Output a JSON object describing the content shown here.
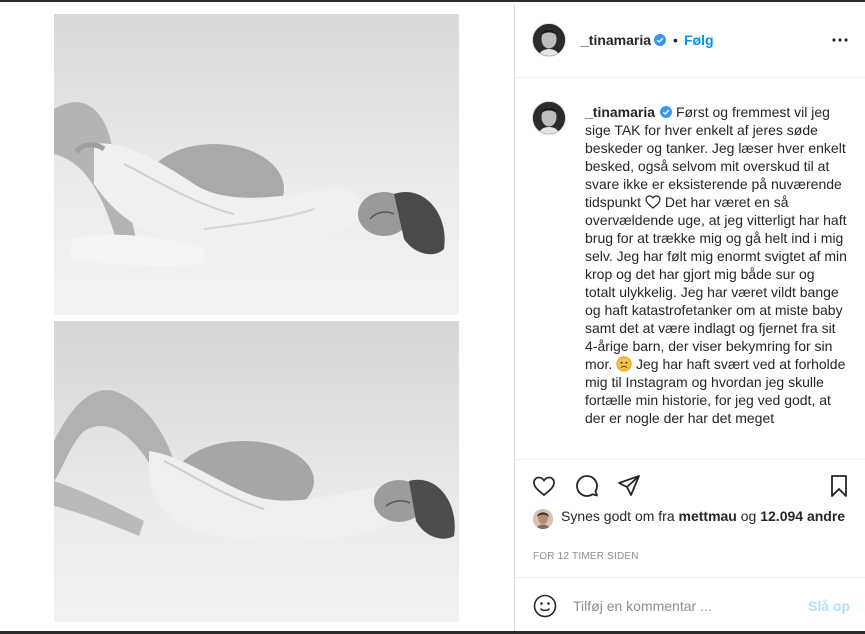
{
  "post": {
    "username": "_tinamaria",
    "verified": true,
    "follow_separator": "•",
    "follow_label": "Følg",
    "caption_before_heart": "Først og fremmest vil jeg sige TAK for hver enkelt af jeres søde beskeder og tanker. Jeg læser hver enkelt besked, også selvom mit overskud til at svare ikke er eksisterende på nuværende tidspunkt",
    "caption_after_heart": " Det har været en så overvældende uge, at jeg vitterligt har haft brug for at trække mig og gå helt ind i mig selv. Jeg har følt mig enormt svigtet af min krop og det har gjort mig både sur og totalt ulykkelig. Jeg har været vildt bange og haft katastrofetanker om at miste baby samt det at være indlagt og fjernet fra sit 4-årige barn, der viser bekymring for sin mor. ",
    "caption_after_sad": "Jeg har haft svært ved at forholde mig til Instagram og hvordan jeg skulle fortælle min historie, for jeg ved godt, at der er nogle der har det meget",
    "likes_prefix": "Synes godt om fra",
    "likes_user": "mettmau",
    "likes_connector": "og",
    "likes_count": "12.094 andre",
    "timestamp": "FOR 12 TIMER SIDEN",
    "comment_placeholder": "Tilføj en kommentar ...",
    "post_button": "Slå op"
  },
  "icons": {
    "like": "heart-outline-icon",
    "comment": "comment-bubble-icon",
    "share": "paper-plane-icon",
    "save": "bookmark-icon",
    "more": "three-dots-icon",
    "emoji": "smiley-icon",
    "verified": "verified-badge-icon",
    "caption_heart": "heart-emoji",
    "caption_sad": "sad-face-emoji"
  },
  "colors": {
    "link_blue": "#0095f6",
    "verified_blue": "#3897f0",
    "post_button_disabled": "#b2dffc",
    "muted_text": "#8e8e8e"
  }
}
